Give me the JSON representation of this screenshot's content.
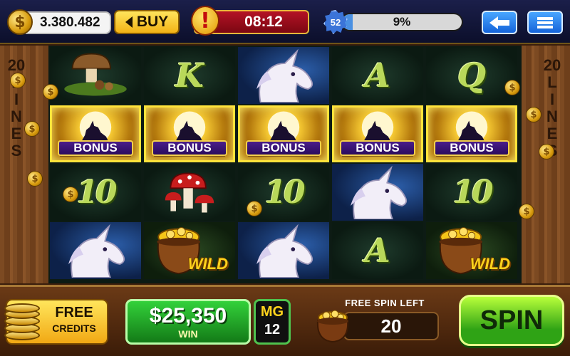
{
  "topbar": {
    "currency_symbol": "$",
    "balance": "3.380.482",
    "buy_label": "BUY",
    "alert_symbol": "!",
    "timer": "08:12",
    "level": "52",
    "xp_percent_label": "9%",
    "xp_fraction": 0.09
  },
  "sides": {
    "lines_label": [
      "20",
      "L",
      "I",
      "N",
      "E",
      "S"
    ]
  },
  "reels": {
    "rows": [
      [
        {
          "type": "mushroom-basket"
        },
        {
          "type": "letter",
          "text": "K"
        },
        {
          "type": "unicorn"
        },
        {
          "type": "letter",
          "text": "A"
        },
        {
          "type": "letter",
          "text": "Q"
        }
      ],
      [
        {
          "type": "bonus",
          "text": "BONUS"
        },
        {
          "type": "bonus",
          "text": "BONUS"
        },
        {
          "type": "bonus",
          "text": "BONUS"
        },
        {
          "type": "bonus",
          "text": "BONUS"
        },
        {
          "type": "bonus",
          "text": "BONUS"
        }
      ],
      [
        {
          "type": "ten",
          "text": "10"
        },
        {
          "type": "mushrooms"
        },
        {
          "type": "ten",
          "text": "10"
        },
        {
          "type": "unicorn"
        },
        {
          "type": "ten",
          "text": "10"
        }
      ],
      [
        {
          "type": "unicorn"
        },
        {
          "type": "wild",
          "text": "WILD"
        },
        {
          "type": "unicorn"
        },
        {
          "type": "letter",
          "text": "A"
        },
        {
          "type": "wild",
          "text": "WILD"
        }
      ]
    ]
  },
  "bottombar": {
    "free_credits_line1": "FREE",
    "free_credits_line2": "CREDITS",
    "win_amount": "$25,350",
    "win_label": "WIN",
    "mg_title": "MG",
    "mg_value": "12",
    "free_spin_label": "FREE SPIN LEFT",
    "free_spins_left": "20",
    "spin_label": "SPIN"
  },
  "colors": {
    "bonus_highlight": "#ffe33b",
    "spin_green": "#2fa315",
    "timer_red": "#b41225",
    "xp_blue": "#4a90e2"
  }
}
